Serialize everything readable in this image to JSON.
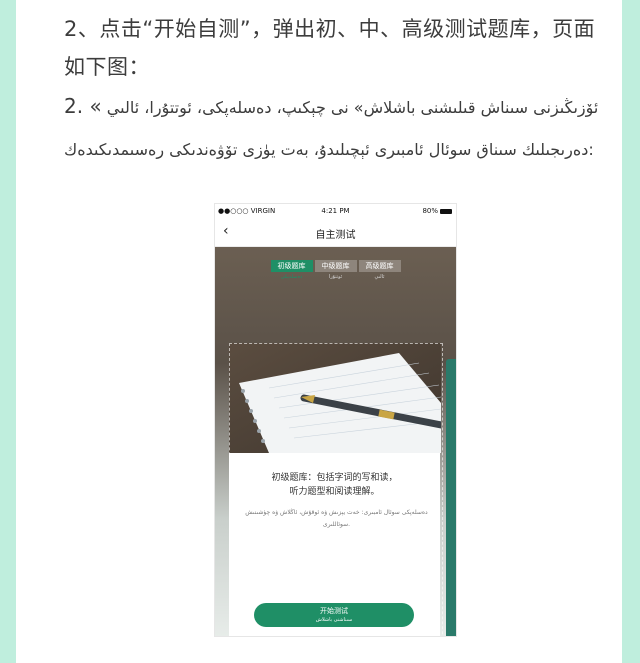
{
  "article": {
    "step2_text": "2、点击“开始自测”，弹出初、中、高级测试题库，页面如下图：",
    "step2_prefix": "2. «",
    "step2_ug": " ئۆزىڭىزنى سىناش قىلىشنى باشلاش» نى چېكىپ، دەسلەپكى، ئوتتۇرا، ئالىي دەرىجىلىك سىناق سوئال ئامبىرى ئېچىلىدۇ، بەت يۈزى تۆۋەندىكى رەسىمدىكىدەك:"
  },
  "phone": {
    "status": {
      "carrier": "●●○○○ VIRGIN",
      "time": "4:21 PM",
      "battery": "80%"
    },
    "nav": {
      "back": "‹",
      "title": "自主测试"
    },
    "tabs": [
      {
        "zh": "初级题库",
        "ug": "دەسلەپكى"
      },
      {
        "zh": "中级题库",
        "ug": "ئوتتۇرا"
      },
      {
        "zh": "高级题库",
        "ug": "ئالىي"
      }
    ],
    "card": {
      "desc_zh_line1": "初级题库：包括字词的写和读，",
      "desc_zh_line2": "听力题型和阅读理解。",
      "desc_ug": "دەسلەپكى سوئال ئامبىرى: خەت يېزىش ۋە ئوقۇش، ئاڭلاش ۋە چۈشىنىش سوئاللىرى."
    },
    "button": {
      "zh": "开始测试",
      "ug": "سىناشنى باشلاش"
    }
  },
  "colors": {
    "accent": "#1f8f66",
    "frame": "#bfeedd"
  }
}
